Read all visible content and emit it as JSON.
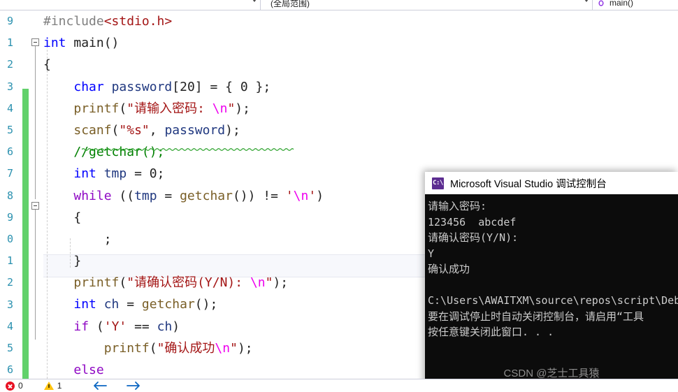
{
  "app": {
    "name": "Microsoft Visual Studio",
    "theme_accent": "#2b91af"
  },
  "navbar": {
    "project_selector": "",
    "scope_selector": "(全局范围)",
    "member_selector": "main()",
    "member_icon": "method-icon",
    "caret_icon": "chevron-down-icon"
  },
  "editor": {
    "line_numbers": [
      "9",
      "1",
      "2",
      "3",
      "4",
      "5",
      "6",
      "7",
      "8",
      "9",
      "0",
      "1",
      "2",
      "3",
      "4",
      "5",
      "6"
    ],
    "lines": [
      {
        "n": 0,
        "tokens": [
          {
            "t": "#include",
            "c": "t-pre"
          },
          {
            "t": "<stdio.h>",
            "c": "t-inc"
          }
        ]
      },
      {
        "n": 1,
        "tokens": [
          {
            "t": "int",
            "c": "t-kw"
          },
          {
            "t": " main",
            "c": "t-plain"
          },
          {
            "t": "()",
            "c": "t-plain"
          }
        ]
      },
      {
        "n": 2,
        "tokens": [
          {
            "t": "{",
            "c": "t-plain"
          }
        ]
      },
      {
        "n": 3,
        "tokens": [
          {
            "t": "    ",
            "c": "t-plain"
          },
          {
            "t": "char",
            "c": "t-kw"
          },
          {
            "t": " ",
            "c": "t-plain"
          },
          {
            "t": "password",
            "c": "t-var"
          },
          {
            "t": "[",
            "c": "t-plain"
          },
          {
            "t": "20",
            "c": "t-num"
          },
          {
            "t": "] = { ",
            "c": "t-plain"
          },
          {
            "t": "0",
            "c": "t-num"
          },
          {
            "t": " };",
            "c": "t-plain"
          }
        ]
      },
      {
        "n": 4,
        "tokens": [
          {
            "t": "    ",
            "c": "t-plain"
          },
          {
            "t": "printf",
            "c": "t-fn"
          },
          {
            "t": "(",
            "c": "t-plain"
          },
          {
            "t": "\"请输入密码: ",
            "c": "t-str"
          },
          {
            "t": "\\n",
            "c": "t-esc"
          },
          {
            "t": "\"",
            "c": "t-str"
          },
          {
            "t": ");",
            "c": "t-plain"
          }
        ]
      },
      {
        "n": 5,
        "tokens": [
          {
            "t": "    ",
            "c": "t-plain"
          },
          {
            "t": "scanf",
            "c": "t-fn"
          },
          {
            "t": "(",
            "c": "t-plain"
          },
          {
            "t": "\"%s\"",
            "c": "t-str"
          },
          {
            "t": ", ",
            "c": "t-plain"
          },
          {
            "t": "password",
            "c": "t-var"
          },
          {
            "t": ");",
            "c": "t-plain"
          }
        ]
      },
      {
        "n": 6,
        "tokens": [
          {
            "t": "    //getchar();",
            "c": "t-cmt"
          }
        ]
      },
      {
        "n": 7,
        "tokens": [
          {
            "t": "    ",
            "c": "t-plain"
          },
          {
            "t": "int",
            "c": "t-kw"
          },
          {
            "t": " ",
            "c": "t-plain"
          },
          {
            "t": "tmp",
            "c": "t-var"
          },
          {
            "t": " = ",
            "c": "t-plain"
          },
          {
            "t": "0",
            "c": "t-num"
          },
          {
            "t": ";",
            "c": "t-plain"
          }
        ]
      },
      {
        "n": 8,
        "tokens": [
          {
            "t": "    ",
            "c": "t-plain"
          },
          {
            "t": "while",
            "c": "t-kwctl"
          },
          {
            "t": " ((",
            "c": "t-plain"
          },
          {
            "t": "tmp",
            "c": "t-var"
          },
          {
            "t": " = ",
            "c": "t-plain"
          },
          {
            "t": "getchar",
            "c": "t-fn"
          },
          {
            "t": "()) != ",
            "c": "t-plain"
          },
          {
            "t": "'",
            "c": "t-str"
          },
          {
            "t": "\\n",
            "c": "t-esc"
          },
          {
            "t": "'",
            "c": "t-str"
          },
          {
            "t": ")",
            "c": "t-plain"
          }
        ]
      },
      {
        "n": 9,
        "tokens": [
          {
            "t": "    {",
            "c": "t-plain"
          }
        ]
      },
      {
        "n": 10,
        "tokens": [
          {
            "t": "        ;",
            "c": "t-plain"
          }
        ]
      },
      {
        "n": 11,
        "tokens": [
          {
            "t": "    }",
            "c": "t-plain"
          }
        ]
      },
      {
        "n": 12,
        "tokens": [
          {
            "t": "    ",
            "c": "t-plain"
          },
          {
            "t": "printf",
            "c": "t-fn"
          },
          {
            "t": "(",
            "c": "t-plain"
          },
          {
            "t": "\"请确认密码(Y/N): ",
            "c": "t-str"
          },
          {
            "t": "\\n",
            "c": "t-esc"
          },
          {
            "t": "\"",
            "c": "t-str"
          },
          {
            "t": ");",
            "c": "t-plain"
          }
        ]
      },
      {
        "n": 13,
        "tokens": [
          {
            "t": "    ",
            "c": "t-plain"
          },
          {
            "t": "int",
            "c": "t-kw"
          },
          {
            "t": " ",
            "c": "t-plain"
          },
          {
            "t": "ch",
            "c": "t-var"
          },
          {
            "t": " = ",
            "c": "t-plain"
          },
          {
            "t": "getchar",
            "c": "t-fn"
          },
          {
            "t": "();",
            "c": "t-plain"
          }
        ]
      },
      {
        "n": 14,
        "tokens": [
          {
            "t": "    ",
            "c": "t-plain"
          },
          {
            "t": "if",
            "c": "t-kwctl"
          },
          {
            "t": " (",
            "c": "t-plain"
          },
          {
            "t": "'Y'",
            "c": "t-str"
          },
          {
            "t": " == ",
            "c": "t-plain"
          },
          {
            "t": "ch",
            "c": "t-var"
          },
          {
            "t": ")",
            "c": "t-plain"
          }
        ]
      },
      {
        "n": 15,
        "tokens": [
          {
            "t": "        ",
            "c": "t-plain"
          },
          {
            "t": "printf",
            "c": "t-fn"
          },
          {
            "t": "(",
            "c": "t-plain"
          },
          {
            "t": "\"确认成功",
            "c": "t-str"
          },
          {
            "t": "\\n",
            "c": "t-esc"
          },
          {
            "t": "\"",
            "c": "t-str"
          },
          {
            "t": ");",
            "c": "t-plain"
          }
        ]
      },
      {
        "n": 16,
        "tokens": [
          {
            "t": "    ",
            "c": "t-plain"
          },
          {
            "t": "else",
            "c": "t-kwctl"
          }
        ]
      }
    ]
  },
  "console": {
    "title": "Microsoft Visual Studio 调试控制台",
    "icon": "console-app-icon",
    "icon_text": "C:\\",
    "output": [
      "请输入密码:",
      "123456  abcdef",
      "请确认密码(Y/N):",
      "Y",
      "确认成功",
      "",
      "C:\\Users\\AWAITXM\\source\\repos\\script\\Debu",
      "要在调试停止时自动关闭控制台，请启用“工具",
      "按任意键关闭此窗口. . ."
    ],
    "watermark": "CSDN @芝士工具猿"
  },
  "statusbar": {
    "error_count": "0",
    "warning_count": "1",
    "error_icon": "error-circle-icon",
    "warning_icon": "warning-triangle-icon",
    "back_icon": "arrow-left-icon",
    "forward_icon": "arrow-right-icon"
  }
}
